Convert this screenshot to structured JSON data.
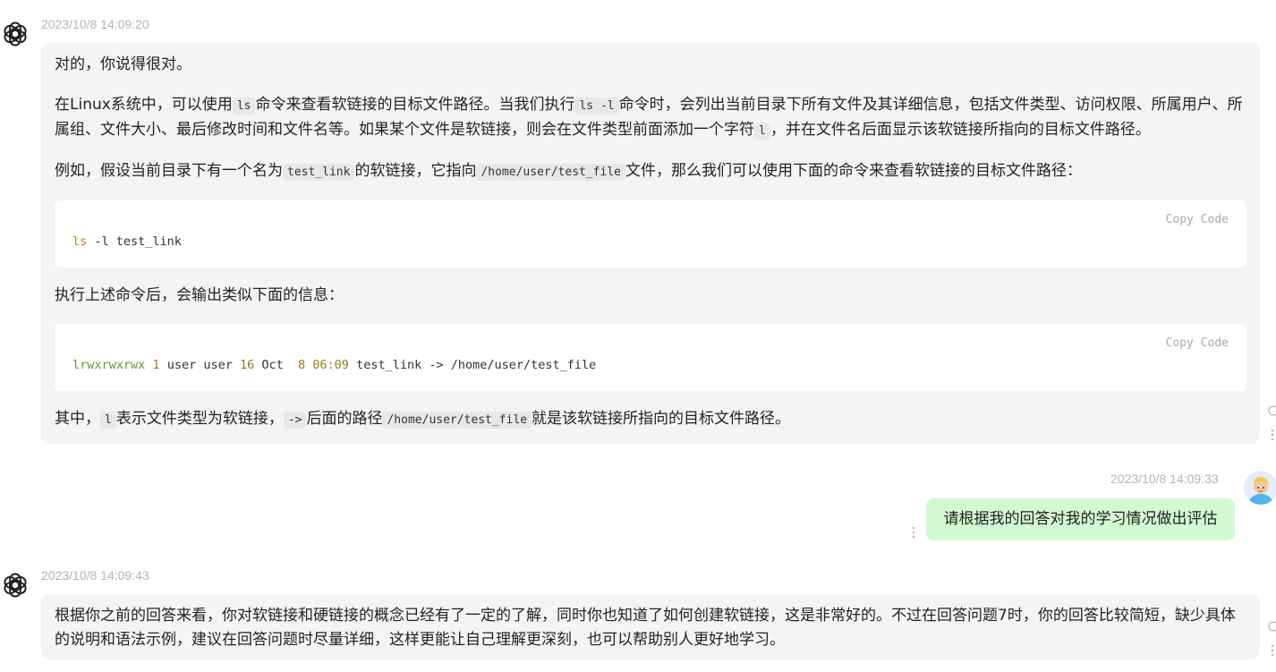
{
  "messages": {
    "ai1": {
      "timestamp": "2023/10/8 14:09:20",
      "p1": "对的，你说得很对。",
      "p2": {
        "a": "在Linux系统中，可以使用",
        "code1": "ls",
        "b": "命令来查看软链接的目标文件路径。当我们执行",
        "code2": "ls -l",
        "c": "命令时，会列出当前目录下所有文件及其详细信息，包括文件类型、访问权限、所属用户、所属组、文件大小、最后修改时间和文件名等。如果某个文件是软链接，则会在文件类型前面添加一个字符",
        "code3": "l",
        "d": "，并在文件名后面显示该软链接所指向的目标文件路径。"
      },
      "p3": {
        "a": "例如，假设当前目录下有一个名为",
        "code1": "test_link",
        "b": "的软链接，它指向",
        "code2": "/home/user/test_file",
        "c": "文件，那么我们可以使用下面的命令来查看软链接的目标文件路径："
      },
      "code_block_1": {
        "copy_label": "Copy Code",
        "cmd": "ls",
        "rest": " -l test_link"
      },
      "p4": "执行上述命令后，会输出类似下面的信息：",
      "code_block_2": {
        "copy_label": "Copy Code",
        "perm": "lrwxrwxrwx",
        "links": "1",
        "owner": " user user ",
        "size": "16",
        "month": " Oct  ",
        "day": "8",
        "time": "06:09",
        "rest": " test_link -> /home/user/test_file"
      },
      "p5": {
        "a": "其中，",
        "code1": "l",
        "b": "表示文件类型为软链接，",
        "code2": "->",
        "c": "后面的路径",
        "code3": "/home/user/test_file",
        "d": "就是该软链接所指向的目标文件路径。"
      }
    },
    "user1": {
      "timestamp": "2023/10/8 14:09:33",
      "text": "请根据我的回答对我的学习情况做出评估"
    },
    "ai2": {
      "timestamp": "2023/10/8 14:09:43",
      "text": "根据你之前的回答来看，你对软链接和硬链接的概念已经有了一定的了解，同时你也知道了如何创建软链接，这是非常好的。不过在回答问题7时，你的回答比较简短，缺少具体的说明和语法示例，建议在回答问题时尽量详细，这样更能让自己理解更深刻，也可以帮助别人更好地学习。"
    }
  },
  "icons": {
    "ai_avatar": "openai-logo-icon",
    "user_avatar": "user-avatar-icon",
    "more": "more-vertical-icon",
    "side_refresh": "circle-icon"
  },
  "colors": {
    "ai_bubble": "#f4f4f5",
    "user_bubble": "#d2f9d1",
    "timestamp": "#b4b4b4",
    "code_keyword": "#b8860b",
    "code_green": "#5a9a3a"
  }
}
